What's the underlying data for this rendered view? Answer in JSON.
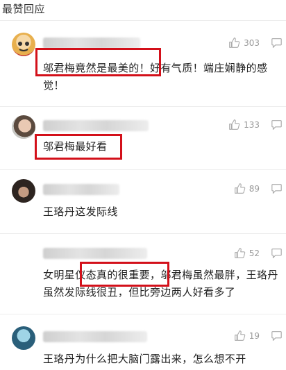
{
  "header": {
    "title": "最赞回应"
  },
  "comments": [
    {
      "likes": "303",
      "text": "邬君梅竟然是最美的！好有气质！端庄娴静的感觉！"
    },
    {
      "likes": "133",
      "text": "邬君梅最好看"
    },
    {
      "likes": "89",
      "text": "王珞丹这发际线"
    },
    {
      "likes": "52",
      "text": "女明星仪态真的很重要，邬君梅虽然最胖，王珞丹虽然发际线很丑，但比旁边两人好看多了"
    },
    {
      "likes": "19",
      "text": "王珞丹为什么把大脑门露出来，怎么想不开"
    }
  ],
  "colors": {
    "highlight": "#d3101a",
    "meta": "#999999",
    "text": "#222222"
  }
}
